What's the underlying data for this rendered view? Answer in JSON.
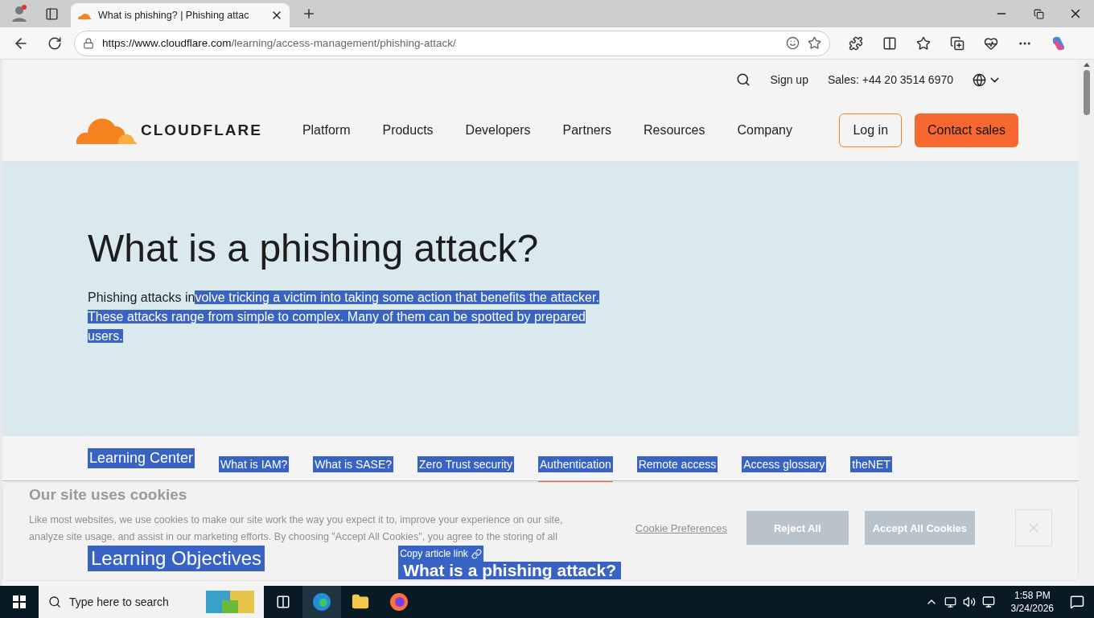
{
  "browser": {
    "tab": {
      "title": "What is phishing? | Phishing attac",
      "selected": true
    },
    "url": {
      "host": "https://www.cloudflare.com",
      "path": "/learning/access-management/phishing-attack/"
    }
  },
  "utility_bar": {
    "sign_up": "Sign up",
    "sales": "Sales: +44 20 3514 6970"
  },
  "header": {
    "logo": "CLOUDFLARE",
    "nav": [
      "Platform",
      "Products",
      "Developers",
      "Partners",
      "Resources",
      "Company"
    ],
    "login": "Log in",
    "contact": "Contact sales"
  },
  "hero": {
    "title": "What is a phishing attack?",
    "intro_unselected": "Phishing attacks in",
    "intro_selected": "volve tricking a victim into taking some action that benefits the attacker. These attacks range from simple to complex. Many of them can be spotted by prepared users."
  },
  "subnav": {
    "home": "Learning Center",
    "items": [
      {
        "label": "What is IAM?",
        "selected": false
      },
      {
        "label": "What is SASE?",
        "selected": false
      },
      {
        "label": "Zero Trust security",
        "selected": false
      },
      {
        "label": "Authentication",
        "selected": true
      },
      {
        "label": "Remote access",
        "selected": false
      },
      {
        "label": "Access glossary",
        "selected": false
      },
      {
        "label": "theNET",
        "selected": false
      }
    ]
  },
  "cookie_banner": {
    "title": "Our site uses cookies",
    "body": "Like most websites, we use cookies to make our site work the way you expect it to, improve your experience on our site, analyze site usage, and assist in our marketing efforts. By choosing \"Accept All Cookies\", you agree to the storing of all",
    "preferences": "Cookie Preferences",
    "reject": "Reject All",
    "accept": "Accept All Cookies"
  },
  "article": {
    "objectives": "Learning Objectives",
    "copy_link": "Copy article link",
    "heading": "What is a phishing attack?"
  },
  "taskbar": {
    "search": "Type here to search",
    "time": "1:58 PM",
    "date": "3/24/2026"
  }
}
